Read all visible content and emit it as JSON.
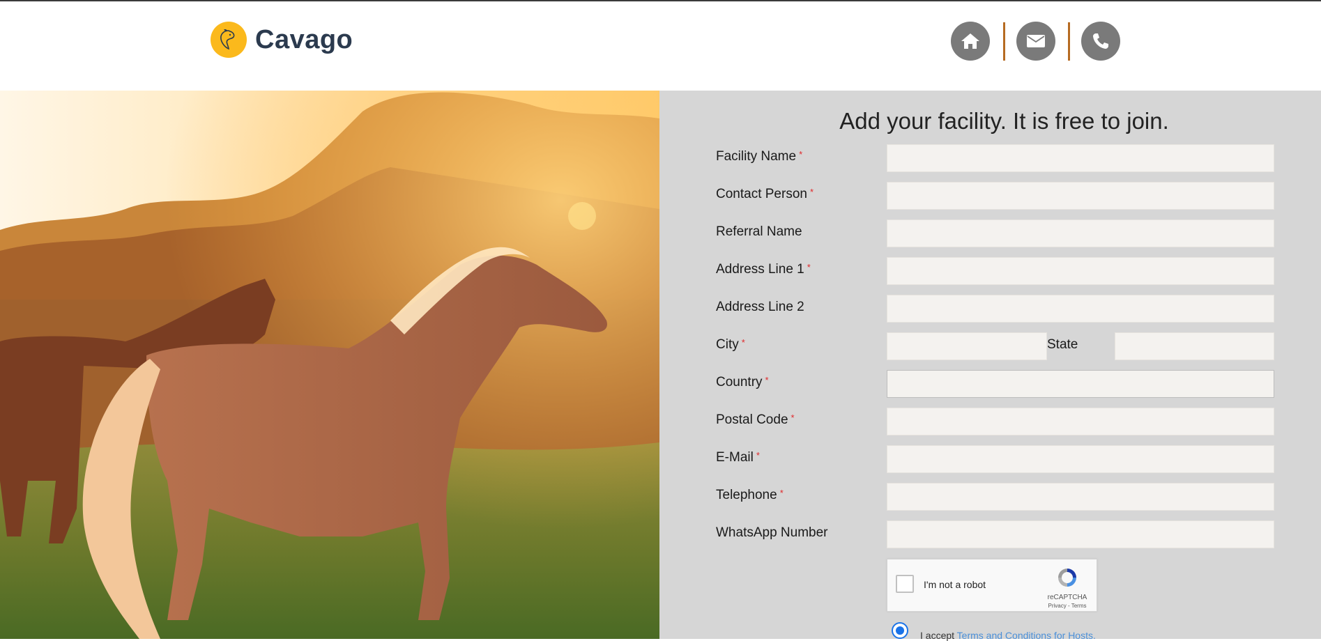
{
  "header": {
    "brand": "Cavago",
    "icons": [
      "home-icon",
      "mail-icon",
      "phone-icon"
    ]
  },
  "form": {
    "title": "Add your facility. It is free to join.",
    "required_mark": "*",
    "fields": {
      "facility_name": "Facility Name",
      "contact_person": "Contact Person",
      "referral_name": "Referral Name",
      "address_line_1": "Address Line 1",
      "address_line_2": "Address Line 2",
      "city": "City",
      "state": "State",
      "country": "Country",
      "postal_code": "Postal Code",
      "email": "E-Mail",
      "telephone": "Telephone",
      "whatsapp": "WhatsApp Number"
    },
    "captcha": {
      "label": "I'm not a robot",
      "brand": "reCAPTCHA",
      "links": "Privacy - Terms"
    },
    "terms": {
      "prefix": "I accept",
      "link": "Terms and Conditions for Hosts."
    }
  },
  "colors": {
    "brand_yellow": "#fbb91c",
    "brand_text": "#2b3a4e",
    "panel_bg": "#d6d6d6",
    "required": "#e0292b",
    "link": "#4a8fd8"
  }
}
